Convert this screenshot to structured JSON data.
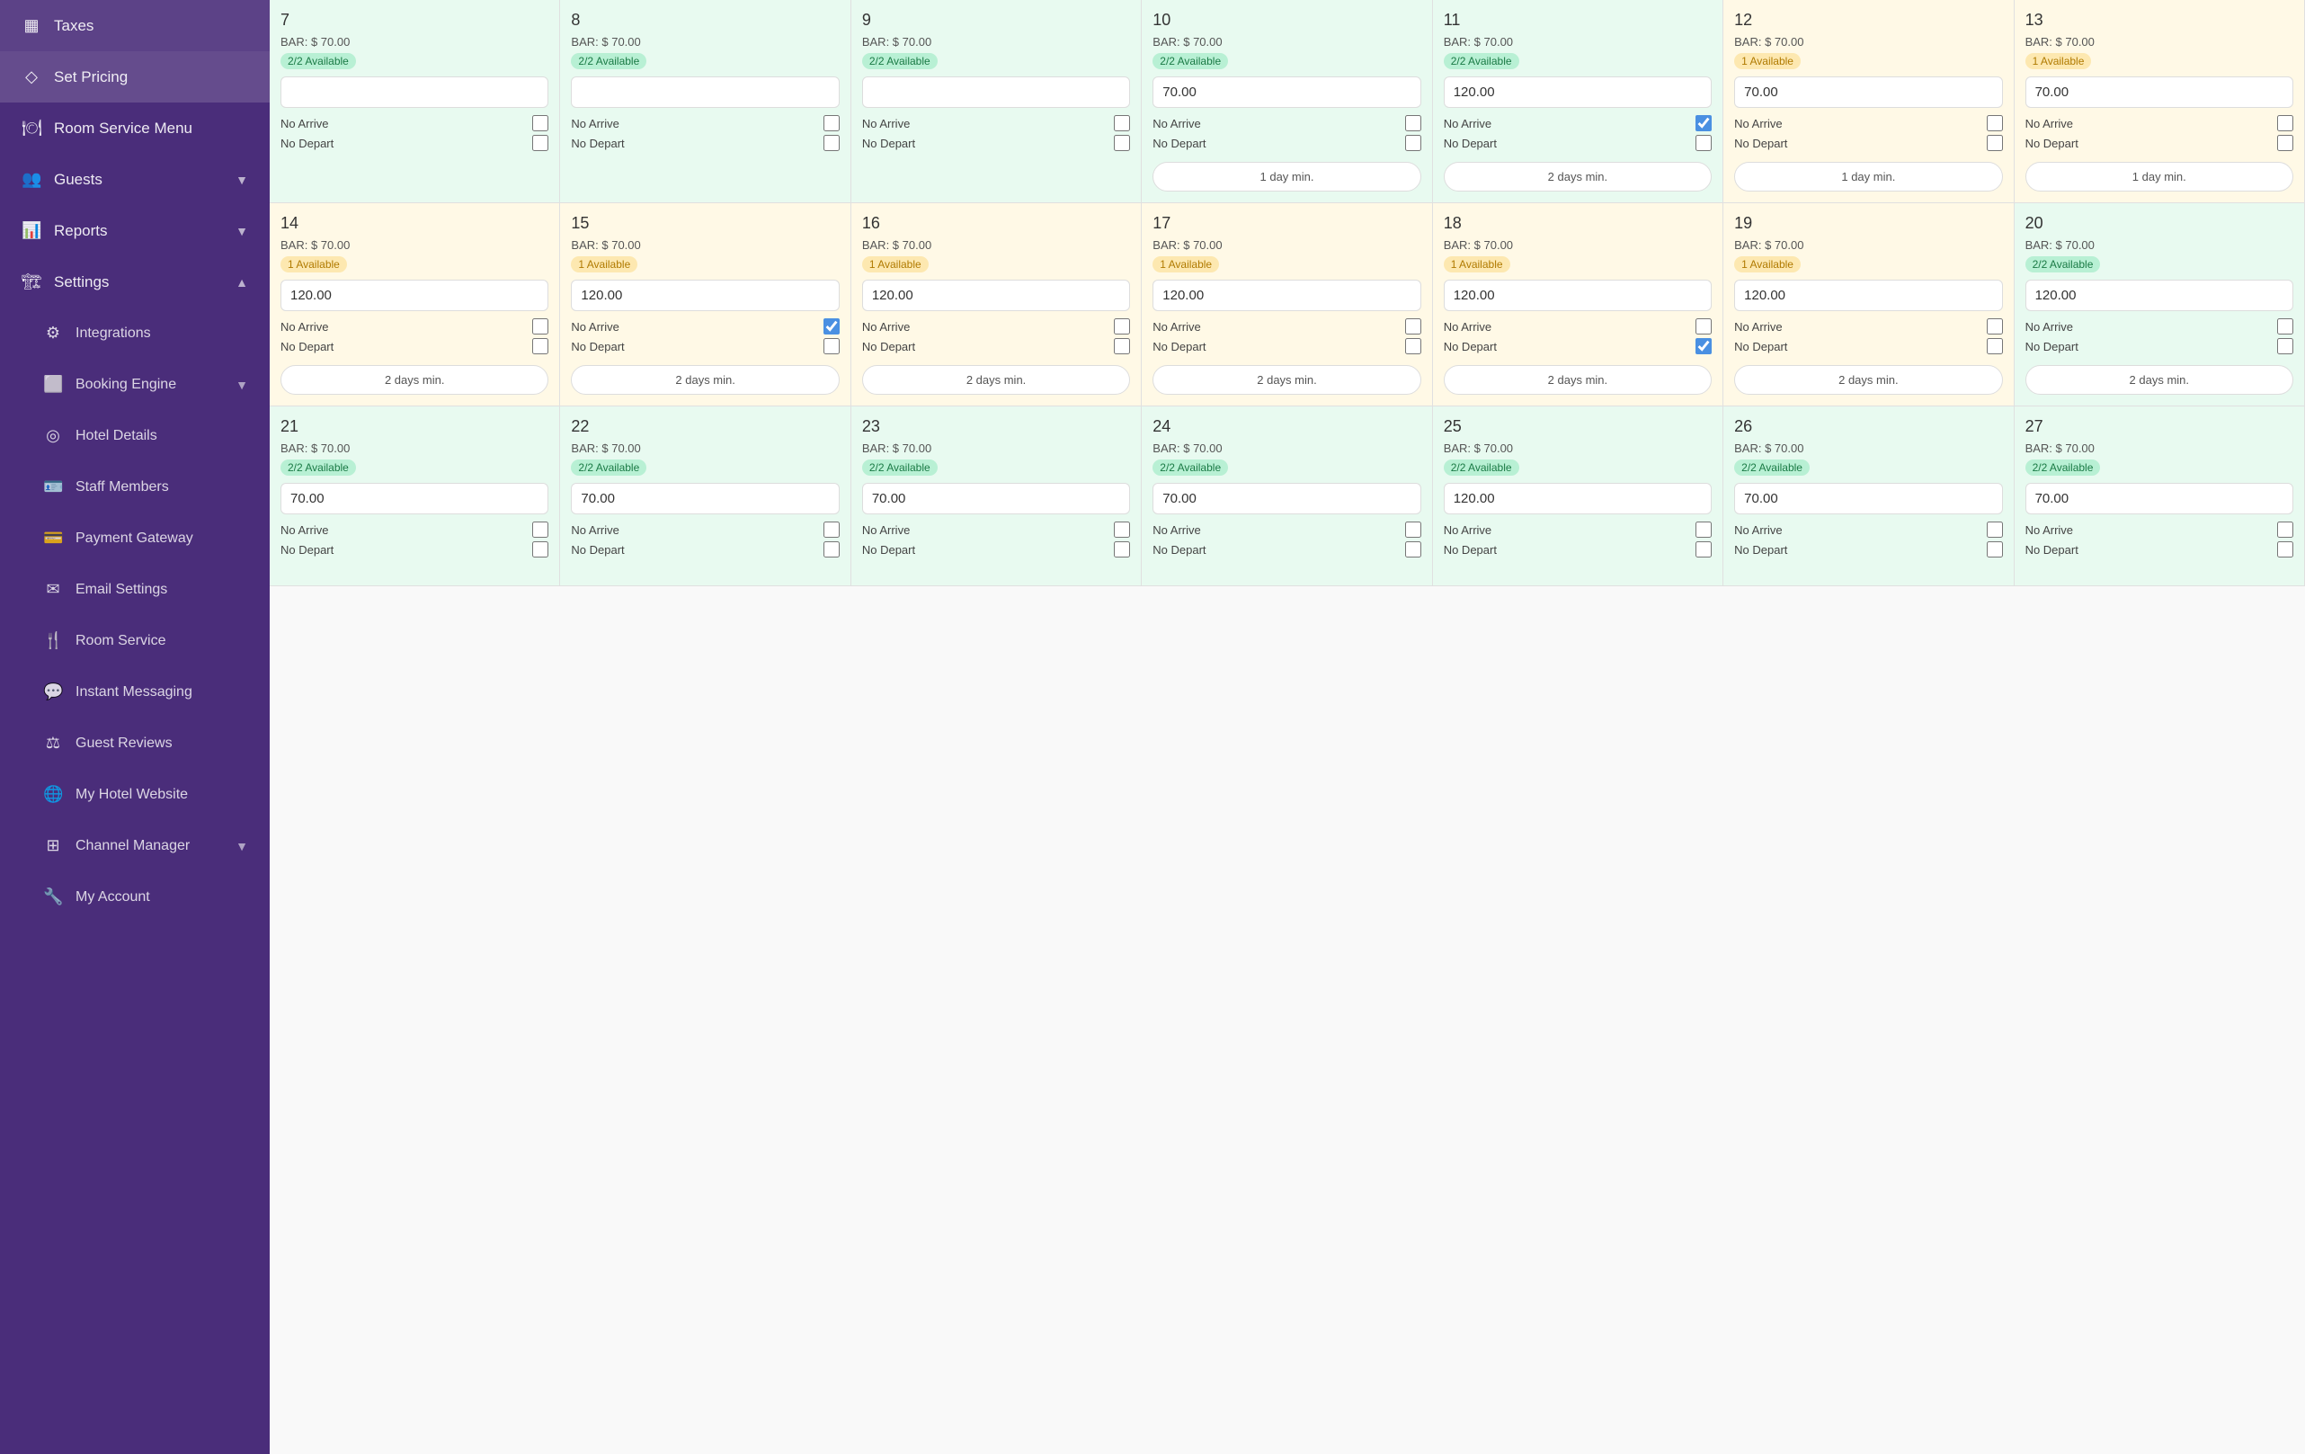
{
  "sidebar": {
    "items": [
      {
        "id": "taxes",
        "label": "Taxes",
        "icon": "▦",
        "hasChevron": false
      },
      {
        "id": "set-pricing",
        "label": "Set Pricing",
        "icon": "◇",
        "hasChevron": false,
        "active": true
      },
      {
        "id": "room-service-menu",
        "label": "Room Service Menu",
        "icon": "🍽",
        "hasChevron": false
      },
      {
        "id": "guests",
        "label": "Guests",
        "icon": "👥",
        "hasChevron": true
      },
      {
        "id": "reports",
        "label": "Reports",
        "icon": "📊",
        "hasChevron": true
      },
      {
        "id": "settings",
        "label": "Settings",
        "icon": "🏗",
        "hasChevron": true,
        "expanded": true
      },
      {
        "id": "integrations",
        "label": "Integrations",
        "icon": "⚙",
        "sub": true
      },
      {
        "id": "booking-engine",
        "label": "Booking Engine",
        "icon": "⬜",
        "sub": true,
        "hasChevron": true
      },
      {
        "id": "hotel-details",
        "label": "Hotel Details",
        "icon": "◎",
        "sub": true
      },
      {
        "id": "staff-members",
        "label": "Staff Members",
        "icon": "🪪",
        "sub": true
      },
      {
        "id": "payment-gateway",
        "label": "Payment Gateway",
        "icon": "💳",
        "sub": true
      },
      {
        "id": "email-settings",
        "label": "Email Settings",
        "icon": "✉",
        "sub": true
      },
      {
        "id": "room-service",
        "label": "Room Service",
        "icon": "🍴",
        "sub": true
      },
      {
        "id": "instant-messaging",
        "label": "Instant Messaging",
        "icon": "💬",
        "sub": true
      },
      {
        "id": "guest-reviews",
        "label": "Guest Reviews",
        "icon": "⚖",
        "sub": true
      },
      {
        "id": "my-hotel-website",
        "label": "My Hotel Website",
        "icon": "🌐",
        "sub": true
      },
      {
        "id": "channel-manager",
        "label": "Channel Manager",
        "icon": "⊞",
        "sub": true,
        "hasChevron": true
      },
      {
        "id": "my-account",
        "label": "My Account",
        "icon": "🔧",
        "sub": true
      }
    ]
  },
  "calendar": {
    "weeks": [
      {
        "days": [
          {
            "num": 7,
            "bar": "$ 70.00",
            "avail": "2/2 Available",
            "availType": "green",
            "price": "",
            "noArrive": false,
            "noDepart": false,
            "minStay": ""
          },
          {
            "num": 8,
            "bar": "$ 70.00",
            "avail": "2/2 Available",
            "availType": "green",
            "price": "",
            "noArrive": false,
            "noDepart": false,
            "minStay": ""
          },
          {
            "num": 9,
            "bar": "$ 70.00",
            "avail": "2/2 Available",
            "availType": "green",
            "price": "",
            "noArrive": false,
            "noDepart": false,
            "minStay": ""
          },
          {
            "num": 10,
            "bar": "$ 70.00",
            "avail": "2/2 Available",
            "availType": "green",
            "price": "70.00",
            "noArrive": false,
            "noDepart": false,
            "minStay": "1 day min."
          },
          {
            "num": 11,
            "bar": "$ 70.00",
            "avail": "2/2 Available",
            "availType": "green",
            "price": "120.00",
            "noArrive": true,
            "noDepart": false,
            "minStay": "2 days min."
          },
          {
            "num": 12,
            "bar": "$ 70.00",
            "avail": "1 Available",
            "availType": "orange",
            "price": "70.00",
            "noArrive": false,
            "noDepart": false,
            "minStay": "1 day min."
          },
          {
            "num": 13,
            "bar": "$ 70.00",
            "avail": "1 Available",
            "availType": "orange",
            "price": "70.00",
            "noArrive": false,
            "noDepart": false,
            "minStay": "1 day min."
          }
        ]
      },
      {
        "days": [
          {
            "num": 14,
            "bar": "$ 70.00",
            "avail": "1 Available",
            "availType": "orange",
            "price": "120.00",
            "noArrive": false,
            "noDepart": false,
            "minStay": "2 days min."
          },
          {
            "num": 15,
            "bar": "$ 70.00",
            "avail": "1 Available",
            "availType": "orange",
            "price": "120.00",
            "noArrive": true,
            "noDepart": false,
            "minStay": "2 days min."
          },
          {
            "num": 16,
            "bar": "$ 70.00",
            "avail": "1 Available",
            "availType": "orange",
            "price": "120.00",
            "noArrive": false,
            "noDepart": false,
            "minStay": "2 days min."
          },
          {
            "num": 17,
            "bar": "$ 70.00",
            "avail": "1 Available",
            "availType": "orange",
            "price": "120.00",
            "noArrive": false,
            "noDepart": false,
            "minStay": "2 days min."
          },
          {
            "num": 18,
            "bar": "$ 70.00",
            "avail": "1 Available",
            "availType": "orange",
            "price": "120.00",
            "noArrive": false,
            "noDepart": true,
            "minStay": "2 days min."
          },
          {
            "num": 19,
            "bar": "$ 70.00",
            "avail": "1 Available",
            "availType": "orange",
            "price": "120.00",
            "noArrive": false,
            "noDepart": false,
            "minStay": "2 days min."
          },
          {
            "num": 20,
            "bar": "$ 70.00",
            "avail": "2/2 Available",
            "availType": "green",
            "price": "120.00",
            "noArrive": false,
            "noDepart": false,
            "minStay": "2 days min."
          }
        ]
      },
      {
        "days": [
          {
            "num": 21,
            "bar": "$ 70.00",
            "avail": "2/2 Available",
            "availType": "green",
            "price": "70.00",
            "noArrive": false,
            "noDepart": false,
            "minStay": ""
          },
          {
            "num": 22,
            "bar": "$ 70.00",
            "avail": "2/2 Available",
            "availType": "green",
            "price": "70.00",
            "noArrive": false,
            "noDepart": false,
            "minStay": ""
          },
          {
            "num": 23,
            "bar": "$ 70.00",
            "avail": "2/2 Available",
            "availType": "green",
            "price": "70.00",
            "noArrive": false,
            "noDepart": false,
            "minStay": ""
          },
          {
            "num": 24,
            "bar": "$ 70.00",
            "avail": "2/2 Available",
            "availType": "green",
            "price": "70.00",
            "noArrive": false,
            "noDepart": false,
            "minStay": ""
          },
          {
            "num": 25,
            "bar": "$ 70.00",
            "avail": "2/2 Available",
            "availType": "green",
            "price": "120.00",
            "noArrive": false,
            "noDepart": false,
            "minStay": ""
          },
          {
            "num": 26,
            "bar": "$ 70.00",
            "avail": "2/2 Available",
            "availType": "green",
            "price": "70.00",
            "noArrive": false,
            "noDepart": false,
            "minStay": ""
          },
          {
            "num": 27,
            "bar": "$ 70.00",
            "avail": "2/2 Available",
            "availType": "green",
            "price": "70.00",
            "noArrive": false,
            "noDepart": false,
            "minStay": ""
          }
        ]
      }
    ],
    "labels": {
      "bar": "BAR:",
      "noArrive": "No Arrive",
      "noDepart": "No Depart"
    }
  }
}
